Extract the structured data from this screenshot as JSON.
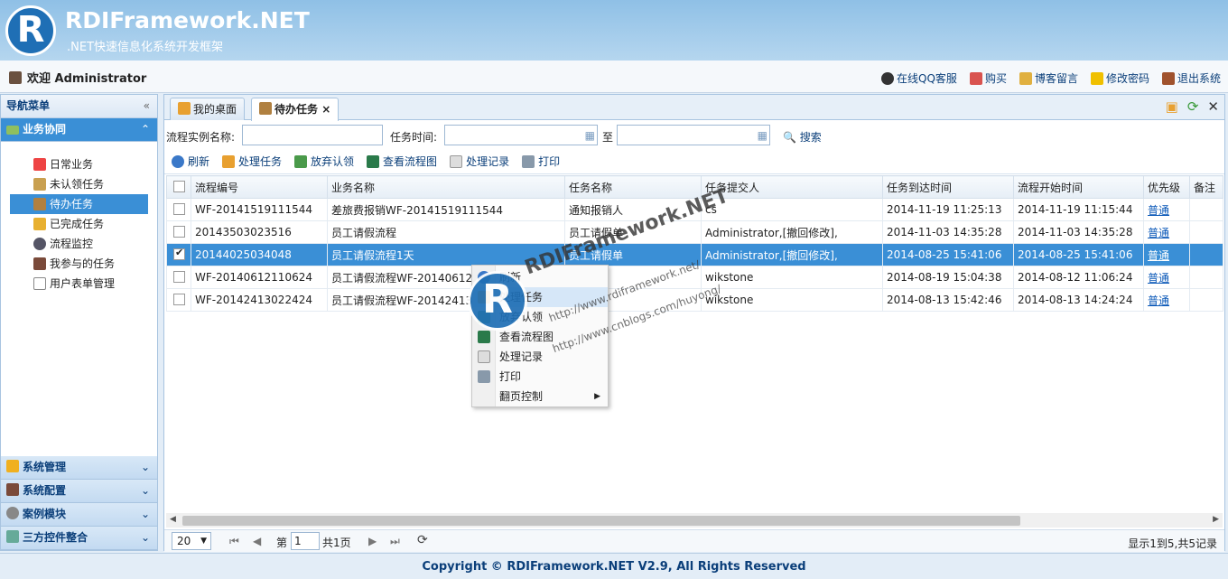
{
  "brand": {
    "logo_letter": "R",
    "title": "RDIFramework.NET",
    "subtitle": ".NET快速信息化系统开发框架"
  },
  "userbar": {
    "welcome": "欢迎 Administrator",
    "links": [
      "在线QQ客服",
      "购买",
      "博客留言",
      "修改密码",
      "退出系统"
    ]
  },
  "sidebar": {
    "title": "导航菜单",
    "collapse": "«",
    "active_group": "业务协同",
    "items": [
      "日常业务",
      "未认领任务",
      "待办任务",
      "已完成任务",
      "流程监控",
      "我参与的任务",
      "用户表单管理"
    ],
    "groups": [
      "系统管理",
      "系统配置",
      "案例模块",
      "三方控件整合"
    ]
  },
  "tabs": [
    {
      "label": "我的桌面"
    },
    {
      "label": "待办任务",
      "close": "×"
    }
  ],
  "search": {
    "name_label": "流程实例名称:",
    "time_label": "任务时间:",
    "to_label": "至",
    "button": "搜索"
  },
  "toolbar": [
    "刷新",
    "处理任务",
    "放弃认领",
    "查看流程图",
    "处理记录",
    "打印"
  ],
  "grid": {
    "headers": [
      "流程编号",
      "业务名称",
      "任务名称",
      "任务提交人",
      "任务到达时间",
      "流程开始时间",
      "优先级",
      "备注"
    ],
    "rows": [
      [
        "WF-20141519111544",
        "差旅费报销WF-20141519111544",
        "通知报销人",
        "cs",
        "2014-11-19 11:25:13",
        "2014-11-19 11:15:44",
        "普通",
        ""
      ],
      [
        "20143503023516",
        "员工请假流程",
        "员工请假单",
        "Administrator,[撤回修改],",
        "2014-11-03 14:35:28",
        "2014-11-03 14:35:28",
        "普通",
        ""
      ],
      [
        "20144025034048",
        "员工请假流程1天",
        "员工请假单",
        "Administrator,[撤回修改],",
        "2014-08-25 15:41:06",
        "2014-08-25 15:41:06",
        "普通",
        ""
      ],
      [
        "WF-20140612110624",
        "员工请假流程WF-20140612110624",
        "人",
        "wikstone",
        "2014-08-19 15:04:38",
        "2014-08-12 11:06:24",
        "普通",
        ""
      ],
      [
        "WF-20142413022424",
        "员工请假流程WF-20142413022424",
        "人",
        "wikstone",
        "2014-08-13 15:42:46",
        "2014-08-13 14:24:24",
        "普通",
        ""
      ]
    ],
    "selected_row": 2
  },
  "pager": {
    "page_size": "20",
    "page_prefix": "第",
    "page": "1",
    "page_suffix": "共1页",
    "status": "显示1到5,共5记录"
  },
  "context_menu": [
    "刷新",
    "处理任务",
    "放弃认领",
    "查看流程图",
    "处理记录",
    "打印",
    "翻页控制"
  ],
  "watermark": {
    "text": "RDIFramework.NET",
    "url1": "http://www.rdiframework.net/",
    "url2": "http://www.cnblogs.com/huyong/"
  },
  "footer": "Copyright © RDIFramework.NET V2.9, All Rights Reserved",
  "colors": {
    "accent": "#3a8fd6",
    "banner": "#8fc0e6",
    "link": "#0b3f7a"
  }
}
